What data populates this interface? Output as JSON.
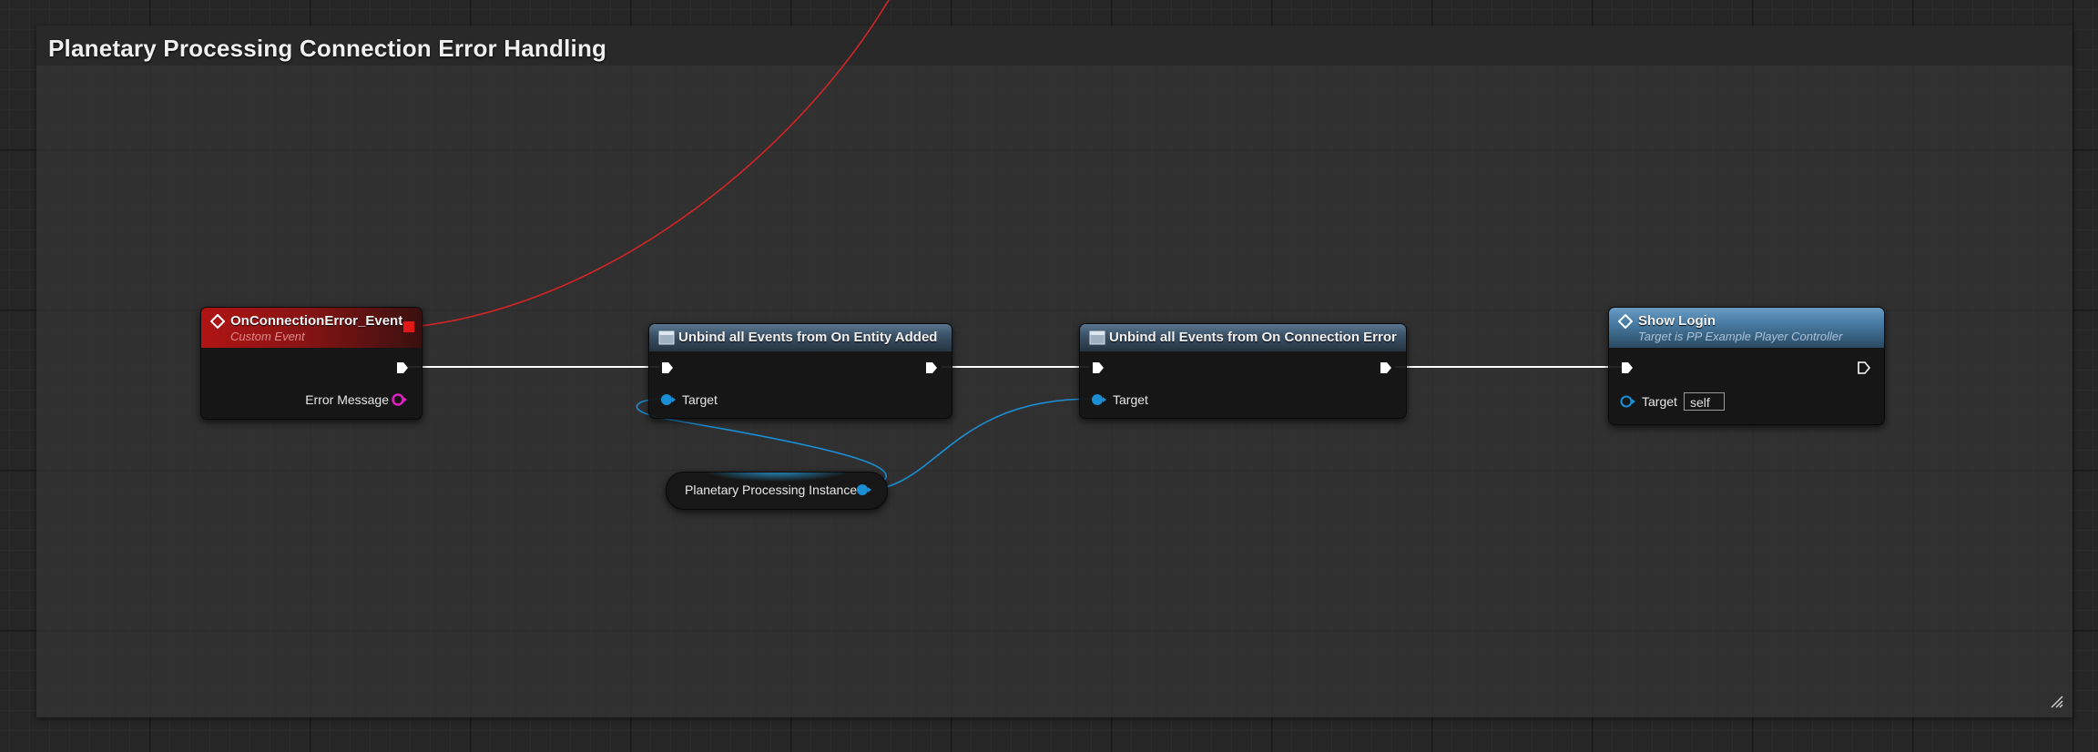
{
  "comment": {
    "title": "Planetary Processing Connection Error Handling"
  },
  "nodes": {
    "event": {
      "title": "OnConnectionError_Event",
      "subtitle": "Custom Event",
      "outputs": [
        "Error Message"
      ]
    },
    "unbind_entity": {
      "title": "Unbind all Events from On Entity Added",
      "inputs": [
        "Target"
      ]
    },
    "unbind_connection": {
      "title": "Unbind all Events from On Connection Error",
      "inputs": [
        "Target"
      ]
    },
    "show_login": {
      "title": "Show Login",
      "subtitle": "Target is PP Example Player Controller",
      "inputs": [
        "Target"
      ],
      "target_default": "self"
    },
    "variable": {
      "label": "Planetary Processing Instance"
    }
  },
  "colors": {
    "event_header": "#8a1414",
    "function_header": "#3c5268",
    "pure_header": "#4a7fa8",
    "exec_wire": "#ffffff",
    "object_wire": "#1a8fd6",
    "delegate_wire": "#d42424",
    "string_pin": "#e020c0"
  },
  "icons": {
    "event": "event-diamond-icon",
    "function": "function-icon",
    "exec": "exec-pin-icon",
    "delegate": "delegate-pin-icon",
    "resize": "resize-grip-icon"
  }
}
